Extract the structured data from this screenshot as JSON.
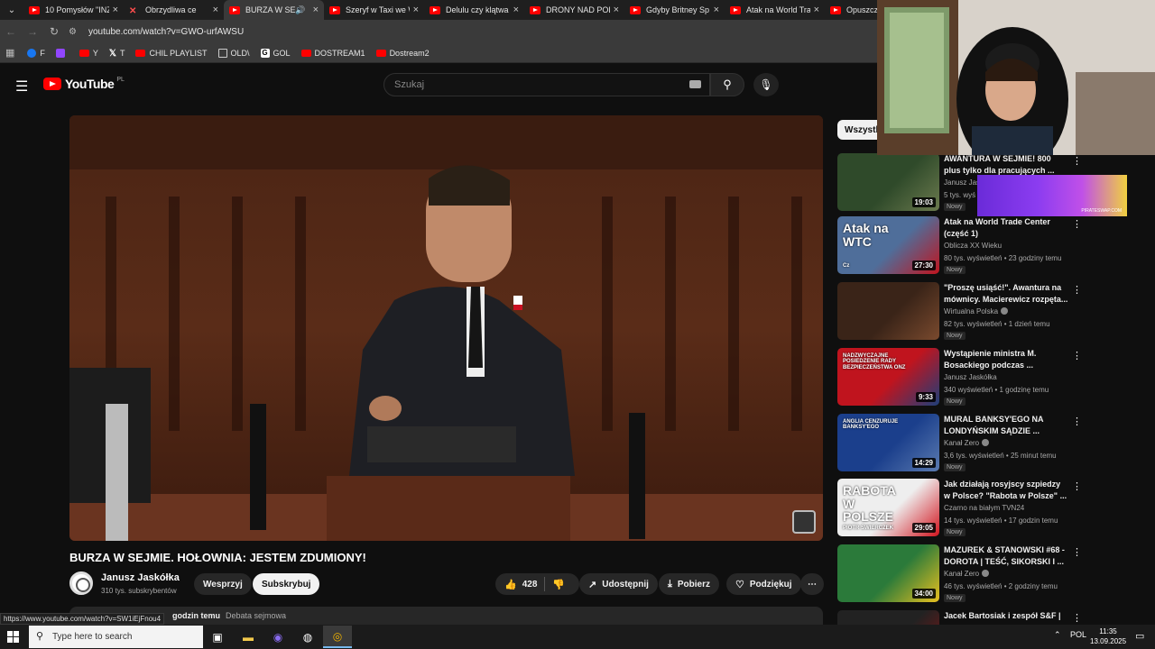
{
  "browser": {
    "tabs": [
      {
        "title": "10 Pomysłów \"INZ",
        "icon": "youtube-icon"
      },
      {
        "title": "Obrzydliwa ce",
        "icon": "cross-icon"
      },
      {
        "title": "BURZA W SEJM",
        "icon": "youtube-icon",
        "active": true,
        "audio": true
      },
      {
        "title": "Szeryf w Taxi we W",
        "icon": "youtube-icon"
      },
      {
        "title": "Delulu czy klątwa",
        "icon": "youtube-icon"
      },
      {
        "title": "DRONY NAD POL",
        "icon": "youtube-icon"
      },
      {
        "title": "Gdyby Britney Sp",
        "icon": "youtube-icon"
      },
      {
        "title": "Atak na World Tra",
        "icon": "youtube-icon"
      },
      {
        "title": "Opuszcz",
        "icon": "youtube-icon"
      }
    ],
    "close_glyph": "×",
    "url": "youtube.com/watch?v=GWO-urfAWSU",
    "bookmarks": [
      {
        "label": "F",
        "icon": "facebook-icon"
      },
      {
        "label": "",
        "icon": "twitch-icon"
      },
      {
        "label": "Y",
        "icon": "youtube-icon"
      },
      {
        "label": "T",
        "icon": "x-icon"
      },
      {
        "label": "CHIL PLAYLIST",
        "icon": "youtube-icon"
      },
      {
        "label": "OLD\\",
        "icon": "folder-icon"
      },
      {
        "label": "GOL",
        "icon": "gol-icon"
      },
      {
        "label": "DOSTREAM1",
        "icon": "youtube-icon"
      },
      {
        "label": "Dostream2",
        "icon": "youtube-icon"
      }
    ],
    "status_url": "https://www.youtube.com/watch?v=SW1iEjFnou4"
  },
  "youtube": {
    "logo_text": "YouTube",
    "logo_region": "PL",
    "search_placeholder": "Szukaj",
    "video": {
      "title": "BURZA W SEJMIE. HOŁOWNIA: JESTEM ZDUMIONY!",
      "channel": "Janusz Jaskółka",
      "subscribers": "310 tys. subskrybentów",
      "support_label": "Wesprzyj",
      "subscribe_label": "Subskrybuj",
      "likes": "428",
      "share_label": "Udostępnij",
      "download_label": "Pobierz",
      "thanks_label": "Podziękuj",
      "desc_time": "godzin temu",
      "desc_tag": "Debata sejmowa"
    },
    "filter_chip": "Wszystk",
    "recommendations": [
      {
        "title": "AWANTURA W SEJMIE! 800 plus tylko dla pracujących ...",
        "channel": "Janusz Jas",
        "meta": "5 tys. wyś",
        "badge": "Nowy",
        "duration": "19:03",
        "thumb": [
          "#2f4a2a",
          "#6b7a4e"
        ]
      },
      {
        "title": "Atak na World Trade Center (część 1)",
        "channel": "Oblicza XX Wieku",
        "meta": "80 tys. wyświetleń • 23 godziny temu",
        "badge": "Nowy",
        "duration": "27:30",
        "thumb_text": "Atak na WTC",
        "thumb_sub": "Cz",
        "thumb": [
          "#4f6e9a",
          "#c0141e"
        ]
      },
      {
        "title": "\"Proszę usiąść!\". Awantura na mównicy. Macierewicz rozpęta...",
        "channel": "Wirtualna Polska",
        "meta": "82 tys. wyświetleń • 1 dzień temu",
        "badge": "Nowy",
        "duration": "",
        "verified": true,
        "thumb": [
          "#3a2418",
          "#7a4a2e"
        ]
      },
      {
        "title": "Wystąpienie ministra M. Bosackiego podczas ...",
        "channel": "Janusz Jaskółka",
        "meta": "340 wyświetleń • 1 godzinę temu",
        "badge": "Nowy",
        "duration": "9:33",
        "thumb_text": "NADZWYCZAJNE POSIEDZENIE RADY BEZPIECZEŃSTWA ONZ",
        "thumb": [
          "#c0141e",
          "#1e3f7a"
        ]
      },
      {
        "title": "MURAL BANKSY'EGO NA LONDYŃSKIM SĄDZIE ...",
        "channel": "Kanał Zero",
        "meta": "3,6 tys. wyświetleń • 25 minut temu",
        "badge": "Nowy",
        "duration": "14:29",
        "verified": true,
        "thumb_text": "ANGLIA CENZURUJE BANKSY'EGO",
        "thumb": [
          "#1b3f8c",
          "#5a7ab0"
        ]
      },
      {
        "title": "Jak działają rosyjscy szpiedzy w Polsce? \"Rabota w Polsze\" ...",
        "channel": "Czarno na białym TVN24",
        "meta": "14 tys. wyświetleń • 17 godzin temu",
        "badge": "Nowy",
        "duration": "29:05",
        "thumb_text": "RABOTA W POLSZE",
        "thumb_sub": "PIOTR ŚWIERCZEK",
        "thumb": [
          "#eeeeee",
          "#d2141e"
        ]
      },
      {
        "title": "MAZUREK & STANOWSKI #68 - DOROTA | TEŚĆ, SIKORSKI I ...",
        "channel": "Kanał Zero",
        "meta": "46 tys. wyświetleń • 2 godziny temu",
        "badge": "Nowy",
        "duration": "34:00",
        "verified": true,
        "thumb": [
          "#2b7a3a",
          "#e8c020"
        ]
      },
      {
        "title": "Jacek Bartosiak i zespół S&F | ...",
        "channel": "",
        "meta": "",
        "badge": "",
        "duration": "",
        "thumb": [
          "#222222",
          "#8a1414"
        ]
      }
    ],
    "promo_text": "PIRATESWAP.COM"
  },
  "taskbar": {
    "search_placeholder": "Type here to search",
    "lang": "POL",
    "time": "11:35",
    "date": "13.09.2025"
  },
  "colors": {
    "youtube_red": "#ff0000",
    "dark_bg": "#0f0f0f",
    "chip_bg": "#272727"
  }
}
